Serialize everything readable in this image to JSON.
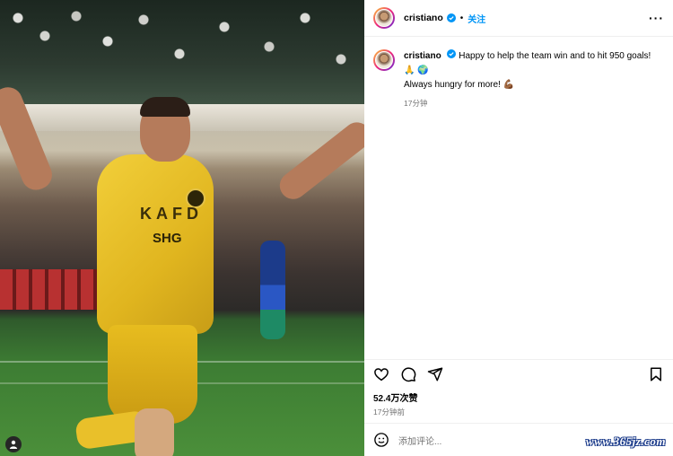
{
  "header": {
    "username": "cristiano",
    "separator": "•",
    "follow_label": "关注",
    "more_label": "···"
  },
  "caption": {
    "username": "cristiano",
    "text_line1": "Happy to help the team win and to hit 950 goals! 🙏 🌍",
    "text_line2": "Always hungry for more! 💪🏾",
    "time": "17分钟"
  },
  "photo": {
    "kit_sponsor_top": "KAFD",
    "kit_sponsor_bottom": "SHG"
  },
  "post": {
    "likes": "52.4万次赞",
    "posted_time": "17分钟前"
  },
  "comment": {
    "placeholder": "添加评论..."
  },
  "watermark": "www.365jz.com",
  "colors": {
    "follow": "#0095f6",
    "verified": "#0095f6",
    "muted": "#737373"
  }
}
